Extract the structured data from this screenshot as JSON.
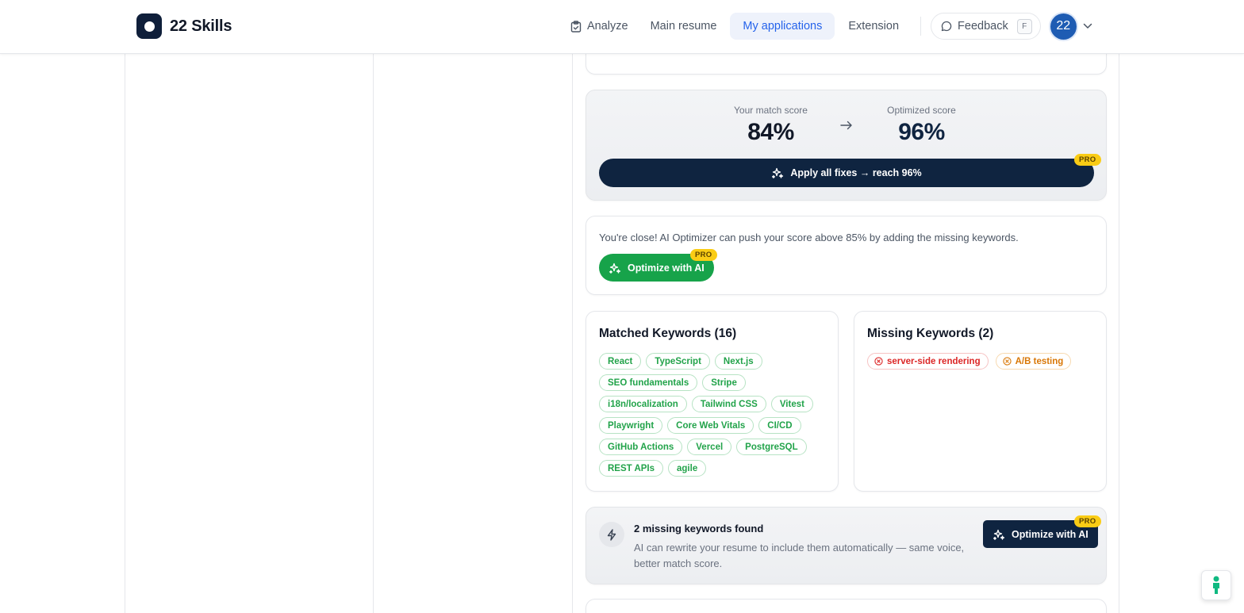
{
  "header": {
    "brand": "22 Skills",
    "nav": [
      {
        "label": "Analyze",
        "icon": "clipboard-icon"
      },
      {
        "label": "Main resume"
      },
      {
        "label": "My applications",
        "active": true
      },
      {
        "label": "Extension"
      }
    ],
    "feedback": {
      "label": "Feedback",
      "shortcut": "F"
    },
    "avatar_text": "22"
  },
  "score": {
    "match_label": "Your match score",
    "match_value": "84%",
    "optimized_label": "Optimized score",
    "optimized_value": "96%",
    "apply_label": "Apply all fixes → reach 96%",
    "pro_badge": "PRO"
  },
  "tip": {
    "text": "You're close! AI Optimizer can push your score above 85% by adding the missing keywords.",
    "button": "Optimize with AI",
    "pro_badge": "PRO"
  },
  "matched": {
    "title": "Matched Keywords (16)",
    "keywords": [
      "React",
      "TypeScript",
      "Next.js",
      "SEO fundamentals",
      "Stripe",
      "i18n/localization",
      "Tailwind CSS",
      "Vitest",
      "Playwright",
      "Core Web Vitals",
      "CI/CD",
      "GitHub Actions",
      "Vercel",
      "PostgreSQL",
      "REST APIs",
      "agile"
    ]
  },
  "missing": {
    "title": "Missing Keywords (2)",
    "keywords": [
      {
        "label": "server-side rendering",
        "severity": "high"
      },
      {
        "label": "A/B testing",
        "severity": "medium"
      }
    ]
  },
  "found": {
    "title": "2 missing keywords found",
    "description": "AI can rewrite your resume to include them automatically — same voice, better match score.",
    "button": "Optimize with AI",
    "pro_badge": "PRO"
  },
  "colors": {
    "brand_dark": "#0f2440",
    "accent_blue": "#2563eb",
    "success_green": "#17a34a",
    "pro_yellow": "#facc15",
    "missing_red": "#dc2626",
    "missing_orange": "#d97706"
  }
}
